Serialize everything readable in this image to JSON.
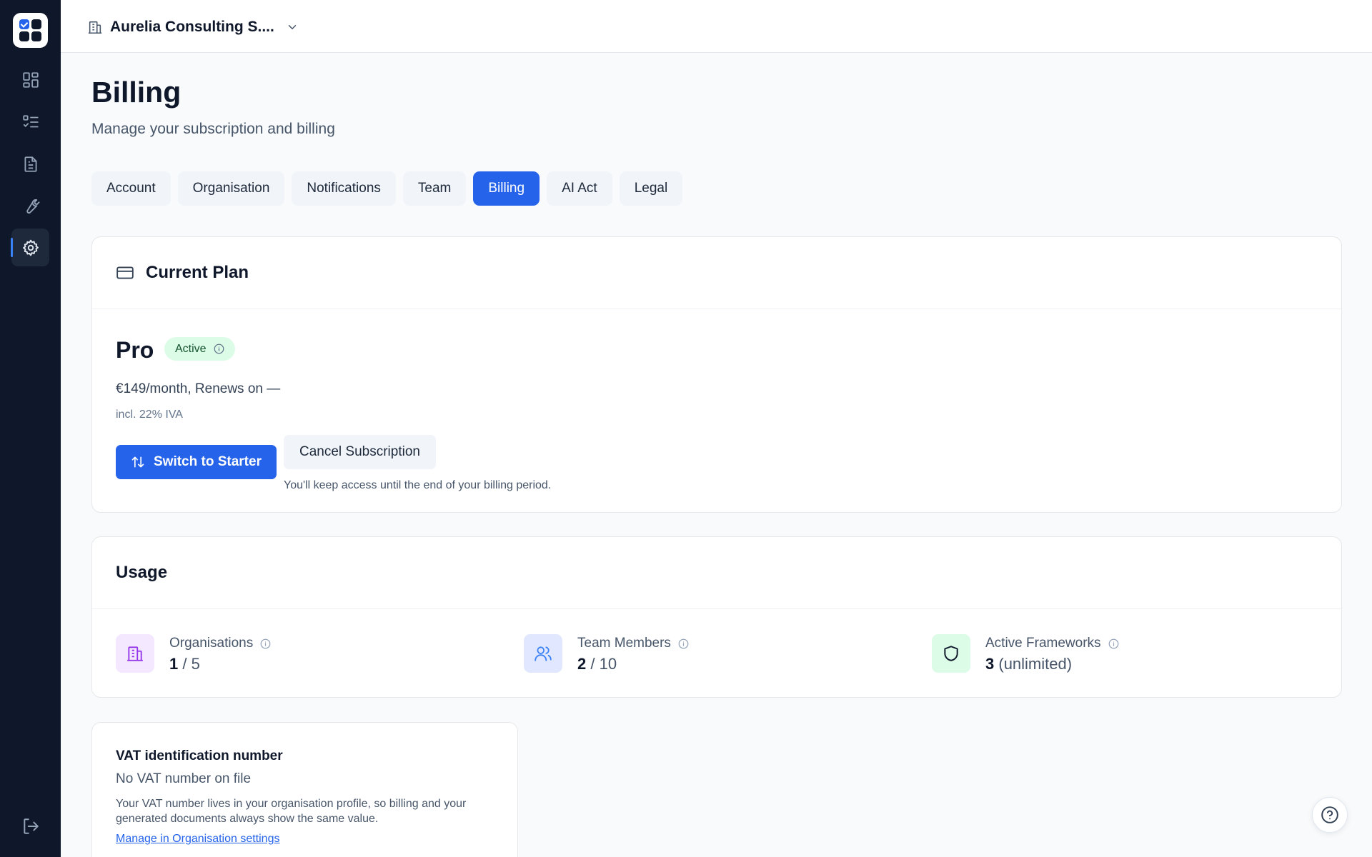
{
  "org": {
    "name": "Aurelia Consulting S...."
  },
  "page": {
    "title": "Billing",
    "subtitle": "Manage your subscription and billing"
  },
  "tabs": [
    {
      "label": "Account",
      "active": false
    },
    {
      "label": "Organisation",
      "active": false
    },
    {
      "label": "Notifications",
      "active": false
    },
    {
      "label": "Team",
      "active": false
    },
    {
      "label": "Billing",
      "active": true
    },
    {
      "label": "AI Act",
      "active": false
    },
    {
      "label": "Legal",
      "active": false
    }
  ],
  "current_plan": {
    "heading": "Current Plan",
    "plan_name": "Pro",
    "status": "Active",
    "price_line": "€149/month, Renews on —",
    "tax_line": "incl. 22% IVA",
    "switch_label": "Switch to Starter",
    "cancel_label": "Cancel Subscription",
    "cancel_note": "You'll keep access until the end of your billing period."
  },
  "usage": {
    "heading": "Usage",
    "items": [
      {
        "label": "Organisations",
        "value": "1",
        "suffix": " / 5",
        "icon": "building-icon",
        "icon_bg": "#f3e8ff",
        "icon_color": "#9333ea"
      },
      {
        "label": "Team Members",
        "value": "2",
        "suffix": " / 10",
        "icon": "users-icon",
        "icon_bg": "#e0e7ff",
        "icon_color": "#3b82f6"
      },
      {
        "label": "Active Frameworks",
        "value": "3",
        "suffix": " (unlimited)",
        "icon": "shield-icon",
        "icon_bg": "#dcfce7",
        "icon_color": "#0f172a"
      }
    ]
  },
  "vat": {
    "title": "VAT identification number",
    "status": "No VAT number on file",
    "description": "Your VAT number lives in your organisation profile, so billing and your generated documents always show the same value.",
    "link": "Manage in Organisation settings"
  },
  "colors": {
    "accent": "#2563eb",
    "sidebar": "#0f172a",
    "active_badge": "#dcfce7"
  }
}
